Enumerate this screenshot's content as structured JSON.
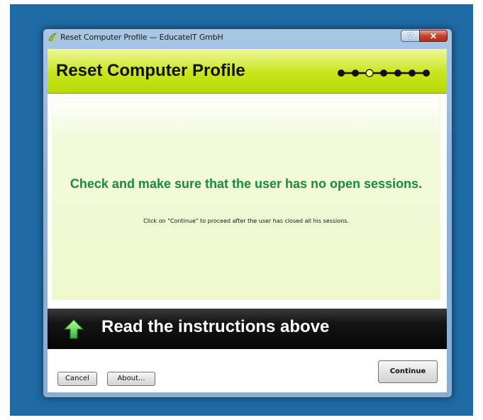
{
  "window": {
    "title": "Reset Computer Profile — EducateIT GmbH",
    "help_label": "?",
    "close_label": "✕"
  },
  "header": {
    "title": "Reset Computer Profile",
    "steps": {
      "total": 7,
      "current": 3
    }
  },
  "content": {
    "headline": "Check and make sure that the user has no open sessions.",
    "subtext": "Click on \"Continue\" to proceed after the user has closed all his sessions."
  },
  "banner": {
    "text": "Read the instructions above",
    "icon": "up-arrow-icon"
  },
  "footer": {
    "cancel_label": "Cancel",
    "about_label": "About...",
    "continue_label": "Continue"
  },
  "colors": {
    "header_accent": "#c7e51c",
    "headline_green": "#198a3c",
    "banner_bg": "#151515",
    "desktop_blue": "#1e6aa6"
  }
}
